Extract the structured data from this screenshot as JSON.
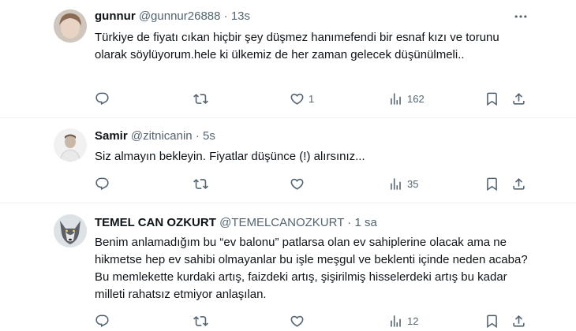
{
  "tweets": [
    {
      "name": "gunnur",
      "handle": "@gunnur26888",
      "sep": "·",
      "time": "13s",
      "text": "Türkiye de fiyatı cıkan hiçbir şey düşmez hanımefendi bir esnaf kızı ve torunu olarak söylüyorum.hele ki ülkemiz de her zaman gelecek düşünülmeli..",
      "replies": "",
      "retweets": "",
      "likes": "1",
      "views": "162"
    },
    {
      "name": "Samir",
      "handle": "@zitnicanin",
      "sep": "·",
      "time": "5s",
      "text": "Siz almayın bekleyin. Fiyatlar düşünce (!) alırsınız...",
      "replies": "",
      "retweets": "",
      "likes": "",
      "views": "35"
    },
    {
      "name": "TEMEL CAN OZKURT",
      "handle": "@TEMELCANOZKURT",
      "sep": "·",
      "time": "1 sa",
      "text": "Benim anlamadığım bu “ev balonu” patlarsa olan ev sahiplerine olacak ama ne hikmetse hep ev sahibi olmayanlar bu işle meşgul ve beklenti içinde neden acaba? Bu memlekette kurdaki artış, faizdeki artış, şişirilmiş hisselerdeki artış bu kadar milleti rahatsız etmiyor anlaşılan.",
      "replies": "",
      "retweets": "",
      "likes": "",
      "views": "12"
    }
  ],
  "icons": {
    "more": "more-icon",
    "reply": "reply-icon",
    "retweet": "retweet-icon",
    "like": "like-icon",
    "views": "views-icon",
    "bookmark": "bookmark-icon",
    "share": "share-icon"
  },
  "colors": {
    "text": "#0f1419",
    "secondary": "#536471",
    "divider": "#eff3f4"
  }
}
